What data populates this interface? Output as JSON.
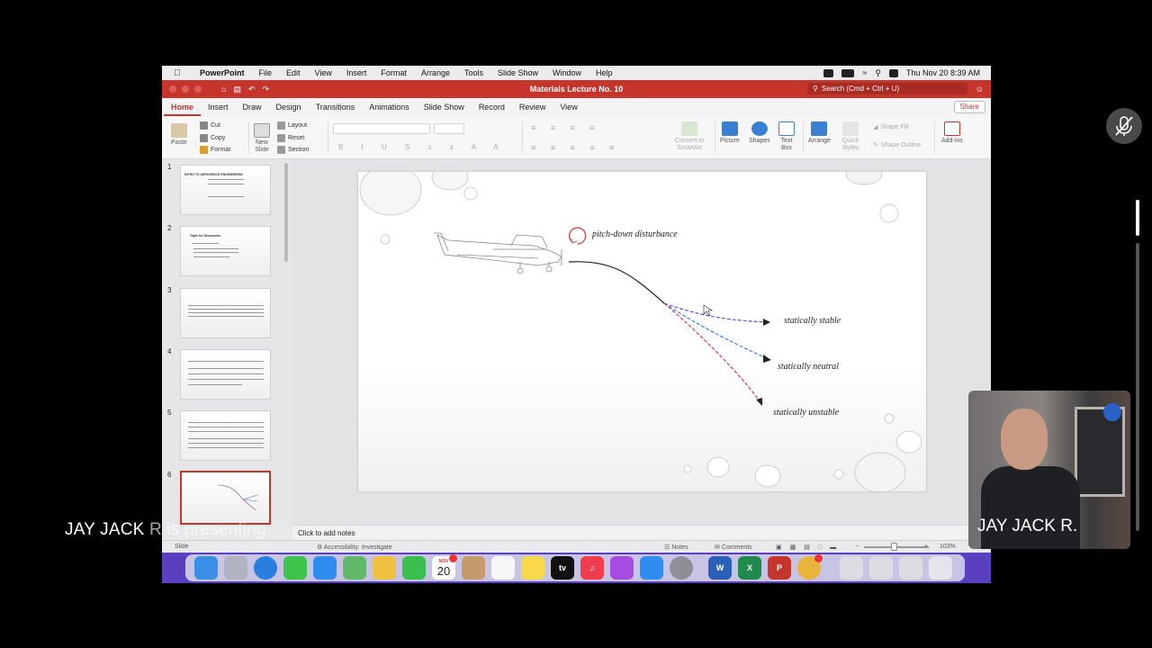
{
  "menubar": {
    "app": "PowerPoint",
    "items": [
      "File",
      "Edit",
      "View",
      "Insert",
      "Format",
      "Arrange",
      "Tools",
      "Slide Show",
      "Window",
      "Help"
    ],
    "datetime": "Thu Nov 20  8:39 AM"
  },
  "titlebar": {
    "doc_title": "Materials Lecture No. 10",
    "search_placeholder": "Search (Cmd + Ctrl + U)"
  },
  "tabs": [
    "Home",
    "Insert",
    "Draw",
    "Design",
    "Transitions",
    "Animations",
    "Slide Show",
    "Record",
    "Review",
    "View"
  ],
  "active_tab": "Home",
  "share_label": "Share",
  "ribbon": {
    "paste": "Paste",
    "cut": "Cut",
    "copy": "Copy",
    "format": "Format",
    "new_slide": "New Slide",
    "layout": "Layout",
    "reset": "Reset",
    "section": "Section",
    "convert_smartart": "Convert to SmartArt",
    "picture": "Picture",
    "shapes": "Shapes",
    "text_box": "Text Box",
    "arrange": "Arrange",
    "quick_styles": "Quick Styles",
    "shape_fill": "Shape Fill",
    "shape_outline": "Shape Outline",
    "add_ins": "Add-ins"
  },
  "thumbnails": [
    {
      "num": "1",
      "title": "INTRO TO AEROSPACE ENGINEERING"
    },
    {
      "num": "2",
      "title": "Topic for Discussion"
    },
    {
      "num": "3",
      "title": ""
    },
    {
      "num": "4",
      "title": ""
    },
    {
      "num": "5",
      "title": ""
    },
    {
      "num": "6",
      "title": ""
    }
  ],
  "slide": {
    "disturbance_label": "pitch-down disturbance",
    "stable_label": "statically stable",
    "neutral_label": "statically neutral",
    "unstable_label": "statically unstable"
  },
  "notes_placeholder": "Click to add notes",
  "status": {
    "slide_info": "Slide",
    "accessibility": "Accessibility: Investigate",
    "notes": "Notes",
    "comments": "Comments",
    "zoom": "103%"
  },
  "dock": {
    "calendar_day": "20",
    "calendar_month": "NOV",
    "tv_label": "tv"
  },
  "overlay": {
    "presenting_name": "JAY JACK",
    "presenting_suffix": "R is presenting",
    "video_name": "JAY JACK R."
  },
  "colors": {
    "ppt_red": "#c6352c",
    "dock_bg": "#5a3fbf",
    "stable_line": "#6a4fd0",
    "neutral_line": "#3a88d8",
    "unstable_line": "#c83a7a"
  }
}
